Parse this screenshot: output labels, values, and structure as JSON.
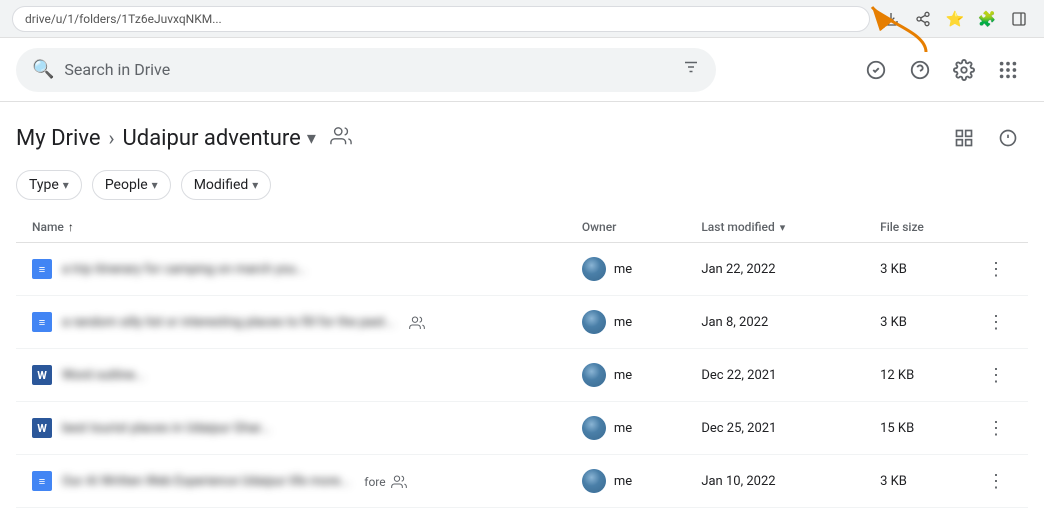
{
  "browser": {
    "url": "drive/u/1/folders/1Tz6eJuvxqNKM...",
    "icons": [
      "download",
      "share",
      "star",
      "extension",
      "sidebar"
    ]
  },
  "search": {
    "placeholder": "Search in Drive",
    "filter_icon": "⊞"
  },
  "header_icons": [
    "check-circle",
    "help",
    "settings",
    "apps"
  ],
  "breadcrumb": {
    "root": "My Drive",
    "current": "Udaipur adventure",
    "share_icon": "👤"
  },
  "filters": [
    {
      "label": "Type",
      "id": "type-filter"
    },
    {
      "label": "People",
      "id": "people-filter"
    },
    {
      "label": "Modified",
      "id": "modified-filter"
    }
  ],
  "table": {
    "columns": {
      "name": "Name",
      "owner": "Owner",
      "modified": "Last modified",
      "size": "File size"
    },
    "rows": [
      {
        "id": "row-1",
        "icon_type": "docs",
        "icon_label": "≡",
        "name": "a trip itinerary for camping on march you...",
        "shared": false,
        "owner": "me",
        "modified": "Jan 22, 2022",
        "size": "3 KB"
      },
      {
        "id": "row-2",
        "icon_type": "docs",
        "icon_label": "≡",
        "name": "a random silly list or interesting places to fill for the past...",
        "shared": true,
        "owner": "me",
        "modified": "Jan 8, 2022",
        "size": "3 KB"
      },
      {
        "id": "row-3",
        "icon_type": "word",
        "icon_label": "W",
        "name": "Word outline...",
        "shared": false,
        "owner": "me",
        "modified": "Dec 22, 2021",
        "size": "12 KB"
      },
      {
        "id": "row-4",
        "icon_type": "word",
        "icon_label": "W",
        "name": "best tourist places in Udaipur Ghar...",
        "shared": false,
        "owner": "me",
        "modified": "Dec 25, 2021",
        "size": "15 KB"
      },
      {
        "id": "row-5",
        "icon_type": "docs",
        "icon_label": "≡",
        "name": "Our AI Written Web Experience Udaipur life more...",
        "shared": true,
        "shared_label": "fore",
        "owner": "me",
        "modified": "Jan 10, 2022",
        "size": "3 KB"
      }
    ]
  },
  "labels": {
    "name_col": "Name",
    "owner_col": "Owner",
    "modified_col": "Last modified",
    "size_col": "File size",
    "type_filter": "Type",
    "people_filter": "People",
    "modified_filter": "Modified",
    "my_drive": "My Drive",
    "folder_name": "Udaipur adventure"
  }
}
